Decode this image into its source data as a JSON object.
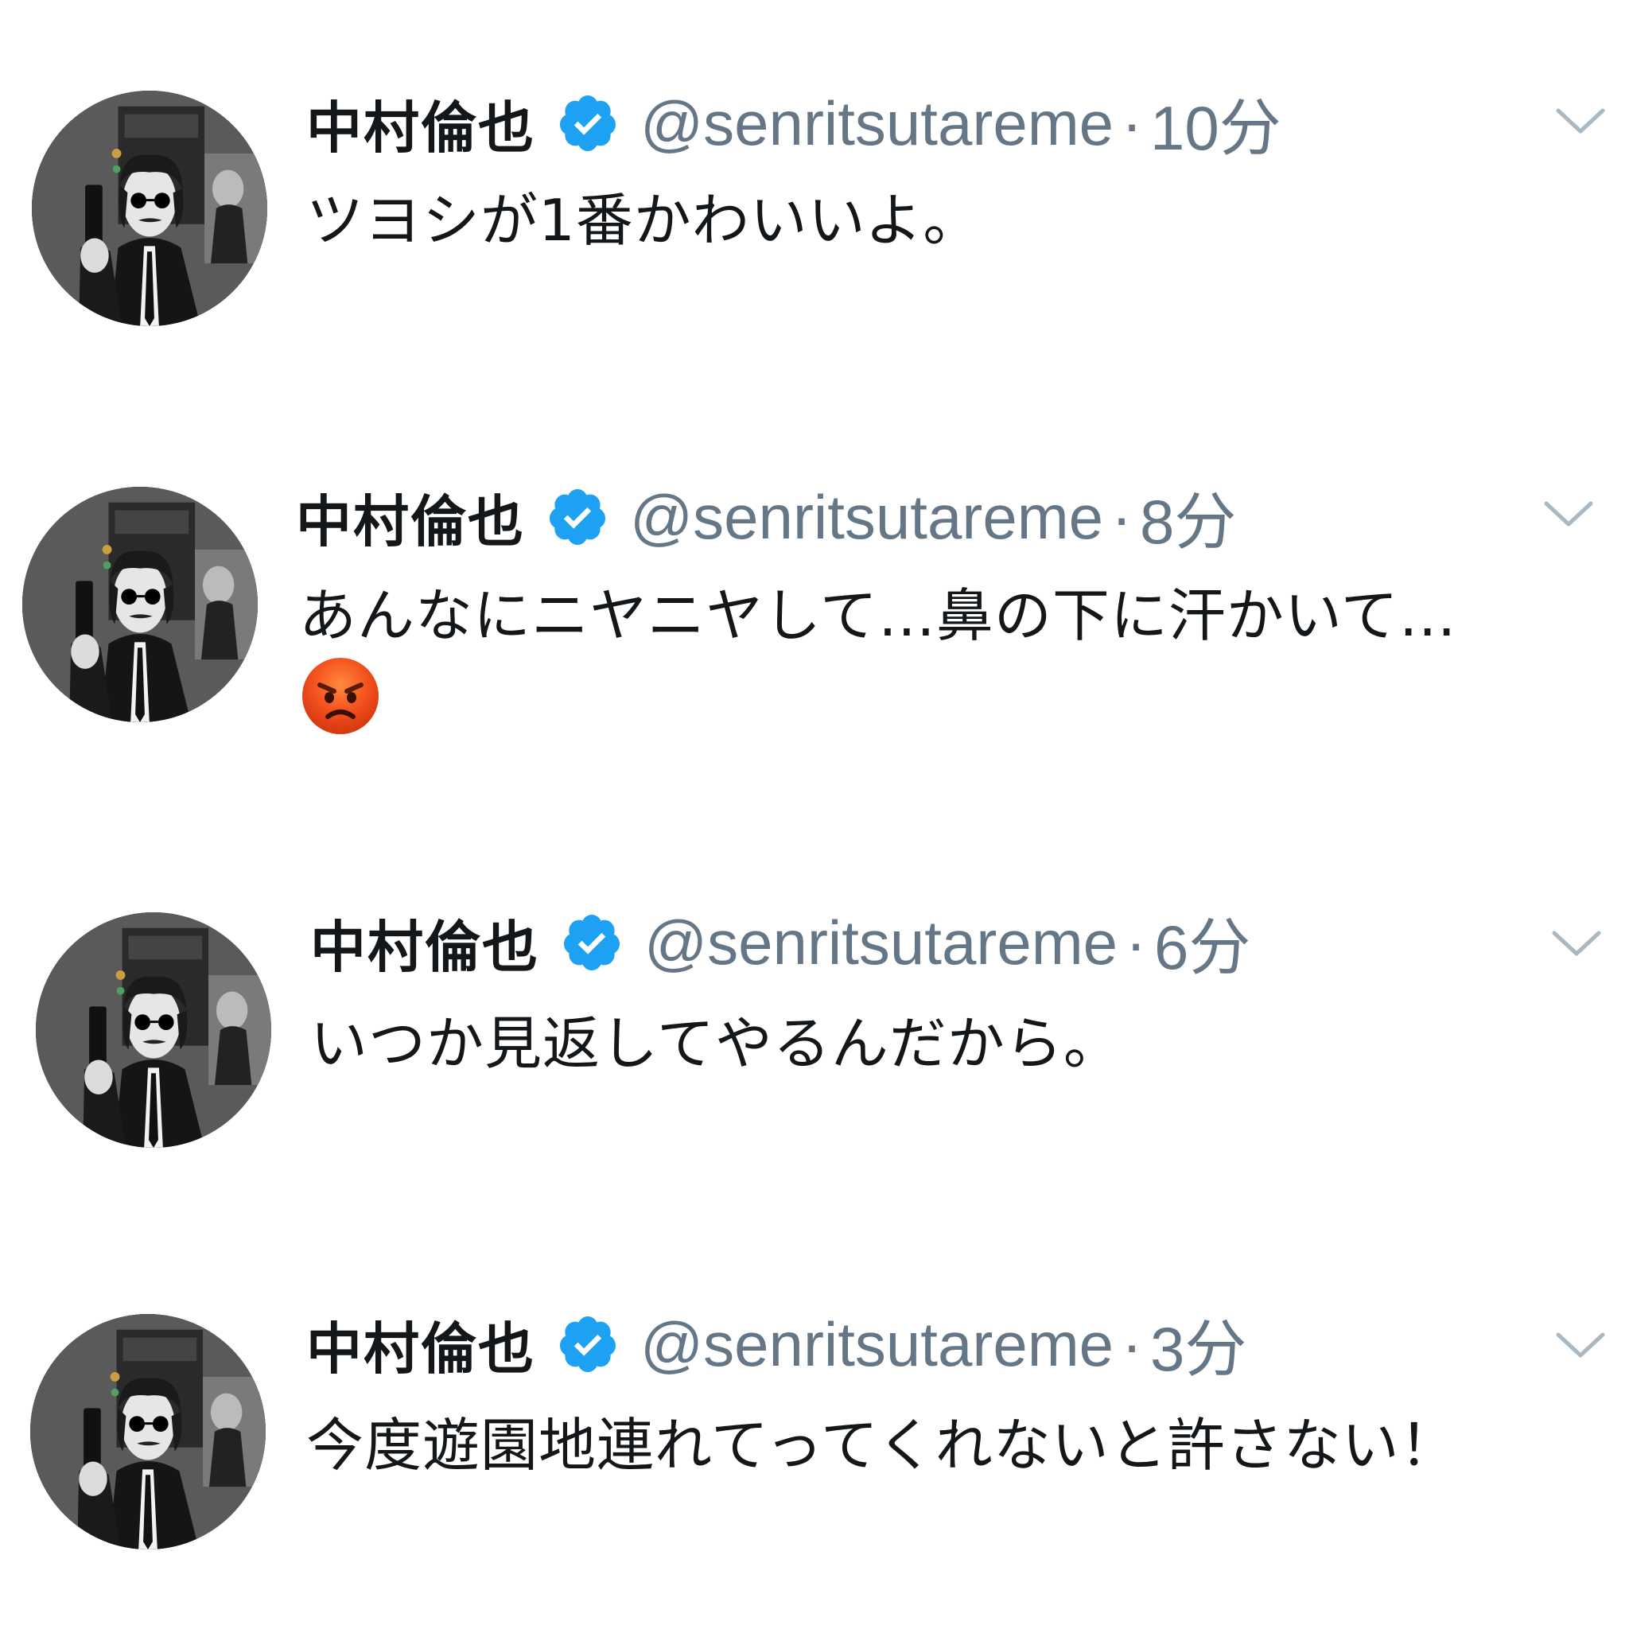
{
  "tweets": [
    {
      "display_name": "中村倫也",
      "handle": "@senritsutareme",
      "separator": "·",
      "time": "10分",
      "text": "ツヨシが1番かわいいよ。"
    },
    {
      "display_name": "中村倫也",
      "handle": "@senritsutareme",
      "separator": "·",
      "time": "8分",
      "text": "あんなにニヤニヤして…鼻の下に汗かいて…",
      "emoji": "angry-face"
    },
    {
      "display_name": "中村倫也",
      "handle": "@senritsutareme",
      "separator": "·",
      "time": "6分",
      "text": "いつか見返してやるんだから。"
    },
    {
      "display_name": "中村倫也",
      "handle": "@senritsutareme",
      "separator": "·",
      "time": "3分",
      "text": "今度遊園地連れてってくれないと許さない！"
    }
  ],
  "colors": {
    "name": "#14171a",
    "handle": "#657786",
    "verified": "#1da1f2",
    "caret": "#aab8c2",
    "background": "#ffffff"
  },
  "icons": {
    "verified": "verified-badge-icon",
    "caret": "chevron-down-icon",
    "emoji": "angry-face-emoji"
  }
}
